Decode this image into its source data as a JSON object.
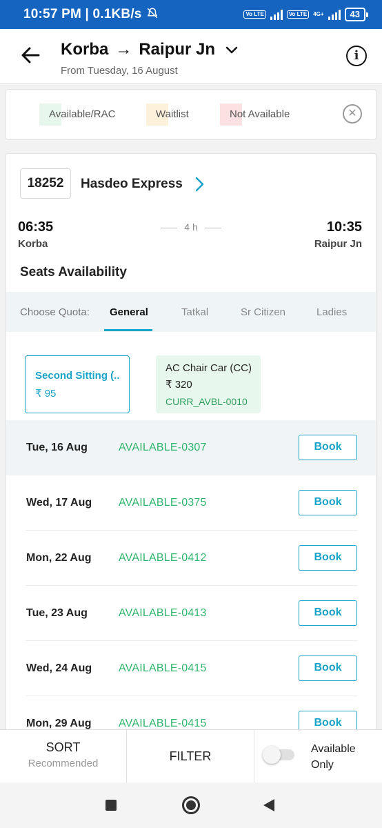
{
  "status_bar": {
    "time": "10:57 PM",
    "speed": "0.1KB/s",
    "volte": "Vo LTE",
    "net": "4G+",
    "battery": "43"
  },
  "header": {
    "origin": "Korba",
    "arrow": "→",
    "destination": "Raipur Jn",
    "subtitle": "From Tuesday, 16 August"
  },
  "legend": {
    "items": [
      {
        "label": "Available/RAC",
        "color": "#e8f7ee"
      },
      {
        "label": "Waitlist",
        "color": "#fdf1dc"
      },
      {
        "label": "Not Available",
        "color": "#fbe1e1"
      }
    ]
  },
  "train": {
    "number": "18252",
    "name": "Hasdeo Express",
    "departure_time": "06:35",
    "departure_station": "Korba",
    "duration": "4 h",
    "arrival_time": "10:35",
    "arrival_station": "Raipur Jn",
    "seats_title": "Seats Availability"
  },
  "quota": {
    "label": "Choose Quota:",
    "tabs": [
      "General",
      "Tatkal",
      "Sr Citizen",
      "Ladies"
    ],
    "active": "General"
  },
  "classes": [
    {
      "name": "Second Sitting (...",
      "price": "₹ 95",
      "status": ""
    },
    {
      "name": "AC Chair Car (CC)",
      "price": "₹ 320",
      "status": "CURR_AVBL-0010"
    }
  ],
  "availability": [
    {
      "date": "Tue, 16 Aug",
      "status": "AVAILABLE-0307",
      "action": "Book"
    },
    {
      "date": "Wed, 17 Aug",
      "status": "AVAILABLE-0375",
      "action": "Book"
    },
    {
      "date": "Mon, 22 Aug",
      "status": "AVAILABLE-0412",
      "action": "Book"
    },
    {
      "date": "Tue, 23 Aug",
      "status": "AVAILABLE-0413",
      "action": "Book"
    },
    {
      "date": "Wed, 24 Aug",
      "status": "AVAILABLE-0415",
      "action": "Book"
    },
    {
      "date": "Mon, 29 Aug",
      "status": "AVAILABLE-0415",
      "action": "Book"
    }
  ],
  "bottom_bar": {
    "sort_label": "SORT",
    "sort_value": "Recommended",
    "filter_label": "FILTER",
    "available_only_label": "Available Only"
  },
  "colors": {
    "status_bar": "#1565c0",
    "accent": "#1aa3c8",
    "available": "#2fb56d"
  }
}
